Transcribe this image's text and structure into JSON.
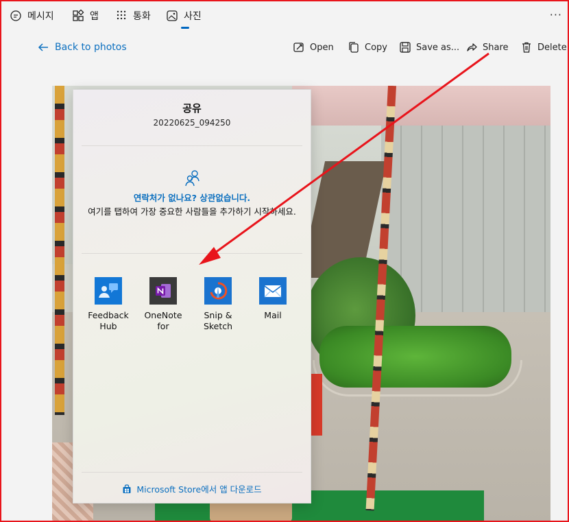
{
  "app_tabs": [
    {
      "label": "메시지",
      "icon": "message-icon"
    },
    {
      "label": "앱",
      "icon": "apps-icon"
    },
    {
      "label": "통화",
      "icon": "dialpad-icon"
    },
    {
      "label": "사진",
      "icon": "photo-icon",
      "active": true
    }
  ],
  "menu_more": "···",
  "toolbar": {
    "back_label": "Back to photos",
    "open_label": "Open",
    "copy_label": "Copy",
    "save_label": "Save as...",
    "share_label": "Share",
    "delete_label": "Delete"
  },
  "share_panel": {
    "title": "공유",
    "filename": "20220625_094250",
    "contacts_title": "연락처가 없나요? 상관없습니다.",
    "contacts_desc": "여기를 탭하여 가장 중요한 사람들을 추가하기 시작하세요.",
    "apps": [
      {
        "name": "Feedback\nHub",
        "icon": "feedback-hub-icon",
        "color": "#1277d6"
      },
      {
        "name": "OneNote\nfor Windows",
        "icon": "onenote-icon",
        "color": "#3a3a3a"
      },
      {
        "name": "Snip &\nSketch",
        "icon": "snip-sketch-icon",
        "color": "#1a73cf"
      },
      {
        "name": "Mail",
        "icon": "mail-icon",
        "color": "#1a73cf"
      }
    ],
    "store_link": "Microsoft Store에서 앱 다운로드"
  },
  "colors": {
    "accent": "#0b6fbf",
    "frame_border": "#e8141b",
    "annotation_arrow": "#e8141b"
  }
}
